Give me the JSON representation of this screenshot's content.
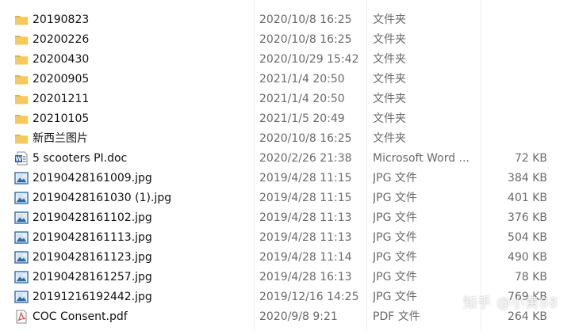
{
  "files": [
    {
      "name": "20190823",
      "date": "2020/10/8 16:25",
      "type": "文件夹",
      "size": "",
      "icon": "folder-icon"
    },
    {
      "name": "20200226",
      "date": "2020/10/8 16:25",
      "type": "文件夹",
      "size": "",
      "icon": "folder-icon"
    },
    {
      "name": "20200430",
      "date": "2020/10/29 15:42",
      "type": "文件夹",
      "size": "",
      "icon": "folder-icon"
    },
    {
      "name": "20200905",
      "date": "2021/1/4 20:50",
      "type": "文件夹",
      "size": "",
      "icon": "folder-icon"
    },
    {
      "name": "20201211",
      "date": "2021/1/4 20:50",
      "type": "文件夹",
      "size": "",
      "icon": "folder-icon"
    },
    {
      "name": "20210105",
      "date": "2021/1/5 20:49",
      "type": "文件夹",
      "size": "",
      "icon": "folder-icon"
    },
    {
      "name": "新西兰图片",
      "date": "2020/10/8 16:25",
      "type": "文件夹",
      "size": "",
      "icon": "folder-icon"
    },
    {
      "name": "5 scooters PI.doc",
      "date": "2020/2/26 21:38",
      "type": "Microsoft Word ...",
      "size": "72 KB",
      "icon": "word-doc-icon"
    },
    {
      "name": "20190428161009.jpg",
      "date": "2019/4/28 11:15",
      "type": "JPG 文件",
      "size": "384 KB",
      "icon": "image-file-icon"
    },
    {
      "name": "20190428161030 (1).jpg",
      "date": "2019/4/28 11:15",
      "type": "JPG 文件",
      "size": "401 KB",
      "icon": "image-file-icon"
    },
    {
      "name": "20190428161102.jpg",
      "date": "2019/4/28 11:13",
      "type": "JPG 文件",
      "size": "376 KB",
      "icon": "image-file-icon"
    },
    {
      "name": "20190428161113.jpg",
      "date": "2019/4/28 11:13",
      "type": "JPG 文件",
      "size": "504 KB",
      "icon": "image-file-icon"
    },
    {
      "name": "20190428161123.jpg",
      "date": "2019/4/28 11:14",
      "type": "JPG 文件",
      "size": "490 KB",
      "icon": "image-file-icon"
    },
    {
      "name": "20190428161257.jpg",
      "date": "2019/4/28 16:13",
      "type": "JPG 文件",
      "size": "78 KB",
      "icon": "image-file-icon"
    },
    {
      "name": "20191216192442.jpg",
      "date": "2019/12/16 14:25",
      "type": "JPG 文件",
      "size": "769 KB",
      "icon": "image-file-icon"
    },
    {
      "name": "COC Consent.pdf",
      "date": "2020/9/8 9:21",
      "type": "PDF 文件",
      "size": "264 KB",
      "icon": "pdf-file-icon"
    }
  ],
  "watermark": "知乎 @小黄88",
  "colors": {
    "folder": "#f5c95b",
    "folder_tab": "#e5b23f",
    "word": "#2b579a",
    "image": "#2d6aa8",
    "pdf": "#d9534f",
    "secondary_text": "#6a6a6a"
  }
}
